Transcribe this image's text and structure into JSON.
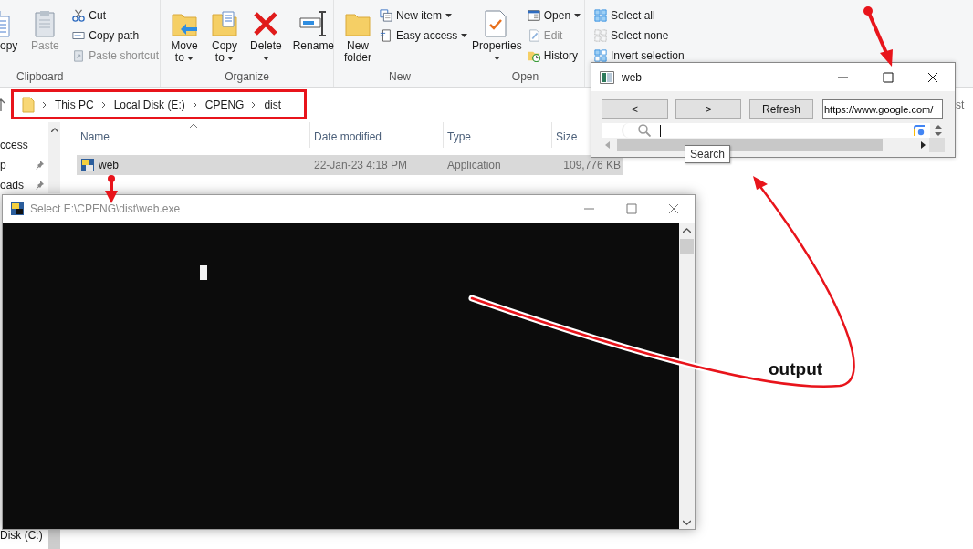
{
  "ribbon": {
    "groups": [
      {
        "label": "Clipboard",
        "large": [
          {
            "label": "opy",
            "disabled": false,
            "dropdown": false
          },
          {
            "label": "Paste",
            "disabled": true,
            "dropdown": false
          }
        ],
        "small": [
          {
            "label": "Cut",
            "disabled": false,
            "dropdown": false
          },
          {
            "label": "Copy path",
            "disabled": false,
            "dropdown": false
          },
          {
            "label": "Paste shortcut",
            "disabled": true,
            "dropdown": false
          }
        ]
      },
      {
        "label": "Organize",
        "large": [
          {
            "label": "Move to",
            "disabled": false,
            "dropdown": true
          },
          {
            "label": "Copy to",
            "disabled": false,
            "dropdown": true
          },
          {
            "label": "Delete",
            "disabled": false,
            "dropdown": true
          },
          {
            "label": "Rename",
            "disabled": false,
            "dropdown": false
          }
        ]
      },
      {
        "label": "New",
        "large": [
          {
            "label": "New folder",
            "disabled": false,
            "dropdown": false
          }
        ],
        "small": [
          {
            "label": "New item",
            "disabled": false,
            "dropdown": true
          },
          {
            "label": "Easy access",
            "disabled": false,
            "dropdown": true
          }
        ]
      },
      {
        "label": "Open",
        "large": [
          {
            "label": "Properties",
            "disabled": false,
            "dropdown": true
          }
        ],
        "small": [
          {
            "label": "Open",
            "disabled": false,
            "dropdown": true
          },
          {
            "label": "Edit",
            "disabled": true,
            "dropdown": false
          },
          {
            "label": "History",
            "disabled": false,
            "dropdown": false
          }
        ]
      },
      {
        "small": [
          {
            "label": "Select all",
            "disabled": false,
            "dropdown": false
          },
          {
            "label": "Select none",
            "disabled": false,
            "dropdown": false
          },
          {
            "label": "Invert selection",
            "disabled": false,
            "dropdown": false
          }
        ]
      }
    ]
  },
  "address_bar": {
    "path": [
      "This PC",
      "Local Disk (E:)",
      "CPENG",
      "dist"
    ],
    "search": "st"
  },
  "navigation_pane": {
    "items": [
      {
        "label": "ccess",
        "pinned": false
      },
      {
        "label": "p",
        "pinned": true
      },
      {
        "label": "oads",
        "pinned": true
      },
      {
        "label": "Disk (C:)",
        "pinned": false
      }
    ]
  },
  "file_list": {
    "columns": [
      {
        "label": "Name",
        "sorted": true
      },
      {
        "label": "Date modified",
        "sorted": false
      },
      {
        "label": "Type",
        "sorted": false
      },
      {
        "label": "Size",
        "sorted": false
      }
    ],
    "rows": [
      {
        "name": "web",
        "date_modified": "22-Jan-23 4:18 PM",
        "type": "Application",
        "size": "109,776 KB",
        "selected": true
      }
    ]
  },
  "console_window": {
    "title": "Select E:\\CPENG\\dist\\web.exe",
    "active": false
  },
  "web_window": {
    "title": "web",
    "active": true,
    "buttons": [
      "<",
      ">",
      "Refresh"
    ],
    "url": "https://www.google.com/",
    "tooltip": "Search"
  },
  "annotation": {
    "label": "output"
  }
}
